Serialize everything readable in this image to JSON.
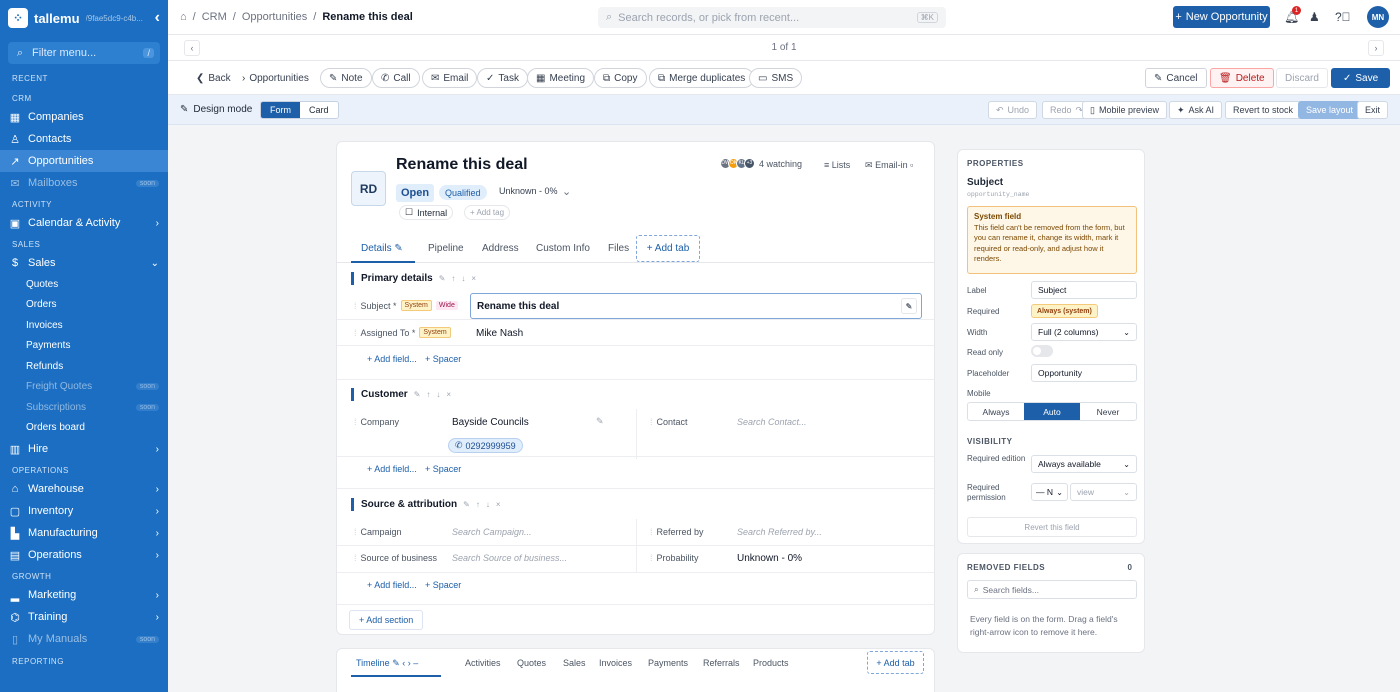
{
  "sidebar": {
    "brand": "tallemu",
    "tenant_id": "/9fae5dc9-c4b...",
    "filter_placeholder": "Filter menu...",
    "filter_kbd": "/",
    "recent_label": "RECENT",
    "crm_label": "CRM",
    "crm_items": [
      {
        "label": "Companies",
        "icon": "building-icon"
      },
      {
        "label": "Contacts",
        "icon": "person-icon"
      },
      {
        "label": "Opportunities",
        "icon": "trend-icon"
      },
      {
        "label": "Mailboxes",
        "icon": "mail-icon",
        "badge": "soon"
      }
    ],
    "activity_label": "ACTIVITY",
    "calendar": "Calendar & Activity",
    "sales_label": "SALES",
    "sales": "Sales",
    "sales_subitems": [
      {
        "label": "Quotes"
      },
      {
        "label": "Orders"
      },
      {
        "label": "Invoices"
      },
      {
        "label": "Payments"
      },
      {
        "label": "Refunds"
      },
      {
        "label": "Freight Quotes",
        "badge": "soon"
      },
      {
        "label": "Subscriptions",
        "badge": "soon"
      },
      {
        "label": "Orders board"
      }
    ],
    "hire": "Hire",
    "operations_label": "OPERATIONS",
    "ops_items": [
      {
        "label": "Warehouse"
      },
      {
        "label": "Inventory"
      },
      {
        "label": "Manufacturing"
      },
      {
        "label": "Operations"
      }
    ],
    "growth_label": "GROWTH",
    "growth_items": [
      {
        "label": "Marketing"
      },
      {
        "label": "Training"
      },
      {
        "label": "My Manuals",
        "badge": "soon"
      }
    ],
    "reporting_label": "REPORTING"
  },
  "topbar": {
    "breadcrumb": [
      "CRM",
      "Opportunities",
      "Rename this deal"
    ],
    "search_placeholder": "Search records, or pick from recent...",
    "search_kbd": "⌘K",
    "new_button": "New Opportunity",
    "notif_count": "1",
    "user_initials": "MN"
  },
  "pager": {
    "text": "1 of 1"
  },
  "actions": {
    "back": "Back",
    "parent": "Opportunities",
    "note": "Note",
    "call": "Call",
    "email": "Email",
    "task": "Task",
    "meeting": "Meeting",
    "copy": "Copy",
    "merge": "Merge duplicates",
    "sms": "SMS",
    "cancel": "Cancel",
    "delete": "Delete",
    "discard": "Discard",
    "save": "Save"
  },
  "design": {
    "label": "Design mode",
    "modes": [
      "Form",
      "Card"
    ],
    "undo": "Undo",
    "redo": "Redo",
    "mobile_preview": "Mobile preview",
    "ask_ai": "Ask AI",
    "revert_stock": "Revert to stock",
    "save_layout": "Save layout",
    "exit": "Exit"
  },
  "record": {
    "initials": "RD",
    "title": "Rename this deal",
    "status": "Open",
    "stage": "Qualified",
    "probability": "Unknown - 0%",
    "internal": "Internal",
    "add_tag": "+ Add tag",
    "watchers": [
      "DW",
      "OK",
      "KL",
      "+3"
    ],
    "watching": "4 watching",
    "lists": "Lists",
    "email_in": "Email-in"
  },
  "tabs": [
    "Details",
    "Pipeline",
    "Address",
    "Custom Info",
    "Files"
  ],
  "add_tab": "+ Add tab",
  "sections": {
    "primary": {
      "title": "Primary details",
      "subject_label": "Subject *",
      "badge_system": "System",
      "badge_wide": "Wide",
      "subject_value": "Rename this deal",
      "assigned_label": "Assigned To *",
      "assigned_value": "Mike Nash"
    },
    "customer": {
      "title": "Customer",
      "company_label": "Company",
      "company_value": "Bayside Councils",
      "phone": "0292999959",
      "contact_label": "Contact",
      "contact_placeholder": "Search Contact..."
    },
    "source": {
      "title": "Source & attribution",
      "campaign_label": "Campaign",
      "campaign_placeholder": "Search Campaign...",
      "referred_label": "Referred by",
      "referred_placeholder": "Search Referred by...",
      "source_label": "Source of business",
      "source_placeholder": "Search Source of business...",
      "probability_label": "Probability",
      "probability_value": "Unknown - 0%"
    },
    "add_field": "+ Add field...",
    "spacer": "+ Spacer",
    "add_section": "+ Add section"
  },
  "bottom_tabs": [
    "Timeline",
    "Activities",
    "Quotes",
    "Sales",
    "Invoices",
    "Payments",
    "Referrals",
    "Products"
  ],
  "properties": {
    "heading": "PROPERTIES",
    "field_name": "Subject",
    "field_key": "opportunity_name",
    "warn_title": "System field",
    "warn_text": "This field can't be removed from the form, but you can rename it, change its width, mark it required or read-only, and adjust how it renders.",
    "label_label": "Label",
    "label_value": "Subject",
    "required_label": "Required",
    "required_value": "Always (system)",
    "width_label": "Width",
    "width_value": "Full (2 columns)",
    "readonly_label": "Read only",
    "placeholder_label": "Placeholder",
    "placeholder_value": "Opportunity",
    "mobile_label": "Mobile",
    "mobile_options": [
      "Always",
      "Auto",
      "Never"
    ],
    "visibility_heading": "VISIBILITY",
    "req_edition_label": "Required edition",
    "req_edition_value": "Always available",
    "req_perm_label": "Required permission",
    "req_perm_value": "— N",
    "req_perm_action": "view",
    "revert_field": "Revert this field"
  },
  "removed": {
    "heading": "REMOVED FIELDS",
    "count": "0",
    "search_placeholder": "Search fields...",
    "note": "Every field is on the form. Drag a field's right-arrow icon to remove it here."
  },
  "colors": {
    "sidebar": "#1b6ec2",
    "primary": "#1d5fa8",
    "danger": "#dc2626"
  }
}
